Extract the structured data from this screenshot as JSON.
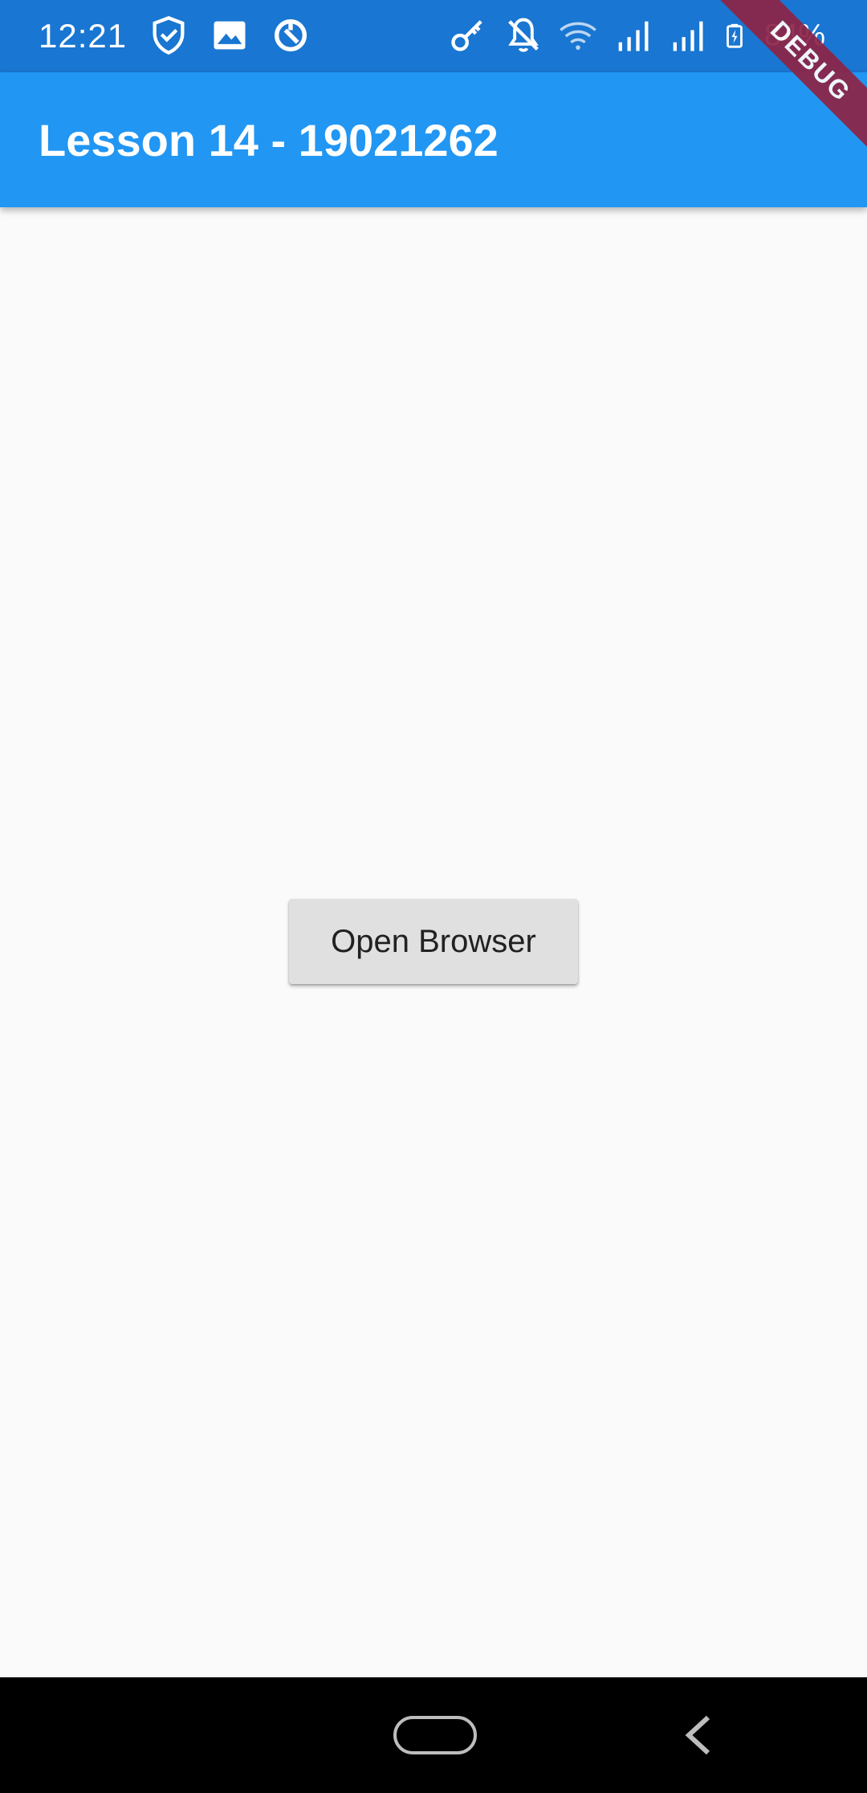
{
  "status_bar": {
    "time": "12:21",
    "battery": "84%",
    "left_icons": [
      "shield-check-icon",
      "image-icon",
      "sync-icon"
    ],
    "right_icons": [
      "vpn-key-icon",
      "notifications-off-icon",
      "wifi-icon",
      "signal-icon",
      "signal-icon",
      "battery-charging-icon"
    ]
  },
  "app_bar": {
    "title": "Lesson 14 - 19021262",
    "color": "#2196f3"
  },
  "debug_banner": {
    "label": "DEBUG"
  },
  "main": {
    "button_label": "Open Browser"
  },
  "colors": {
    "status_bar": "#1976d2",
    "background": "#fafafa",
    "button": "#e0e0e0",
    "banner": "#8e2446"
  }
}
